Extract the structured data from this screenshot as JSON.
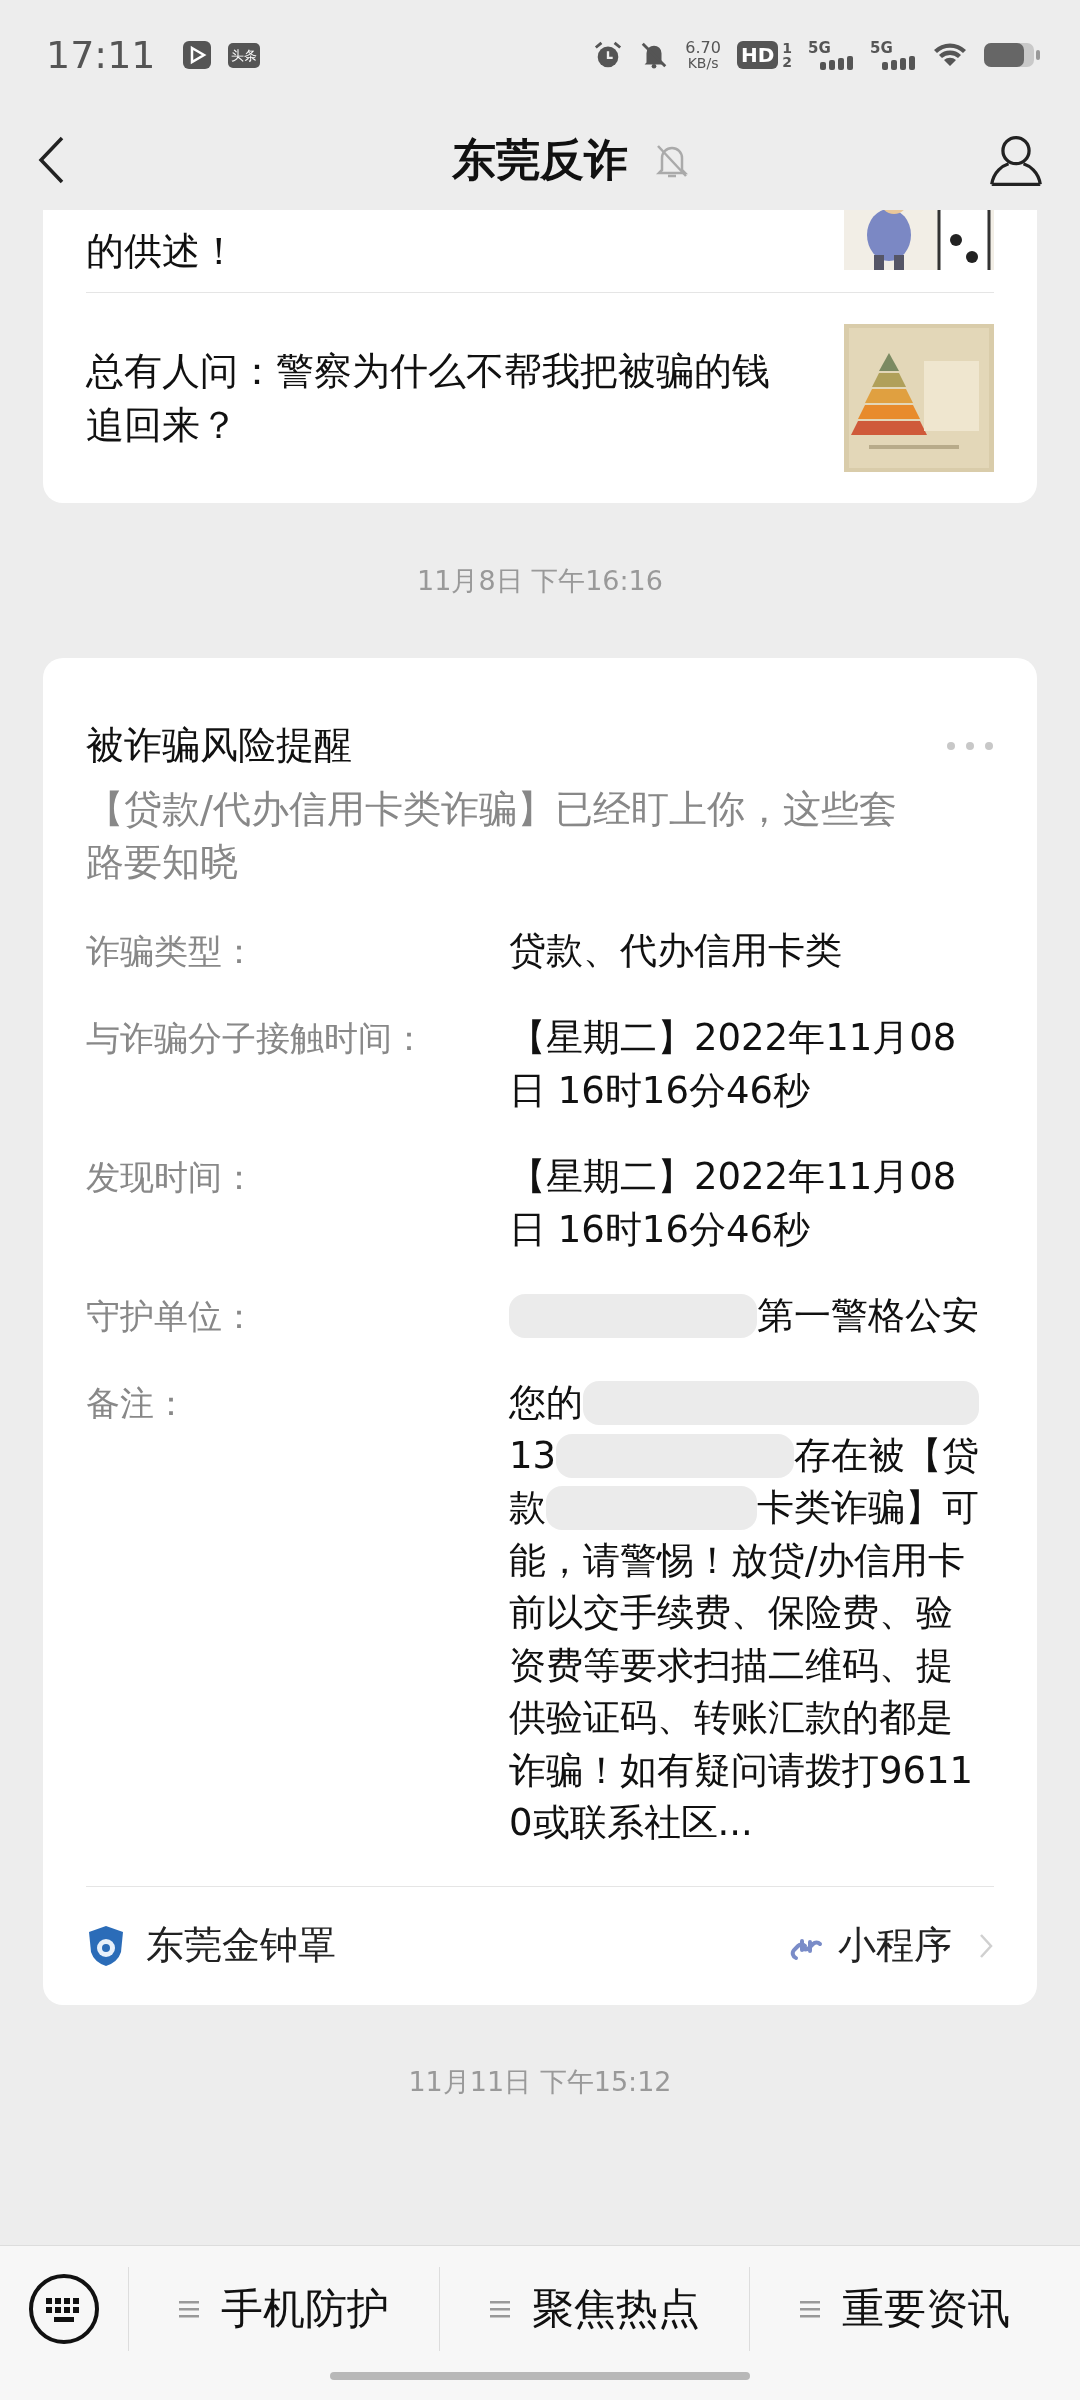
{
  "status_bar": {
    "time": "17:11",
    "app_badge": "头条",
    "speed_value": "6.70",
    "speed_unit": "KB/s",
    "hd": "HD",
    "sim_slots": [
      "1",
      "2"
    ],
    "networks": [
      "5G",
      "5G"
    ]
  },
  "header": {
    "title": "东莞反诈",
    "muted": true
  },
  "articles": [
    {
      "title": "的供述！"
    },
    {
      "title": "总有人问：警察为什么不帮我把被骗的钱追回来？"
    }
  ],
  "timestamps": [
    "11月8日 下午16:16",
    "11月11日 下午15:12"
  ],
  "alert_card": {
    "title": "被诈骗风险提醒",
    "subtitle": "【贷款/代办信用卡类诈骗】已经盯上你，这些套路要知晓",
    "fields": [
      {
        "label": "诈骗类型：",
        "lines": [
          {
            "kind": "text",
            "text": "贷款、代办信用卡类"
          }
        ]
      },
      {
        "label": "与诈骗分子接触时间：",
        "lines": [
          {
            "kind": "text",
            "text": "【星期二】2022年11月08日 16时16分46秒"
          }
        ]
      },
      {
        "label": "发现时间：",
        "lines": [
          {
            "kind": "text",
            "text": "【星期二】2022年11月08日 16时16分46秒"
          }
        ]
      },
      {
        "label": "守护单位：",
        "lines": [
          {
            "kind": "redacted",
            "after": "第一警格公安"
          }
        ]
      },
      {
        "label": "备注：",
        "lines": [
          {
            "kind": "redacted",
            "before": "您的"
          },
          {
            "kind": "redacted",
            "before": "13",
            "after": "存在被【贷"
          },
          {
            "kind": "redacted",
            "before": "款",
            "after": "卡类诈骗】可"
          },
          {
            "kind": "text",
            "text": "能，请警惕！放贷/办信用卡前以交手续费、保险费、验资费等要求扫描二维码、提供验证码、转账汇款的都是诈骗！如有疑问请拨打96110或联系社区..."
          }
        ]
      }
    ],
    "source": "东莞金钟罩",
    "source_type": "小程序"
  },
  "menu": [
    "手机防护",
    "聚焦热点",
    "重要资讯"
  ]
}
